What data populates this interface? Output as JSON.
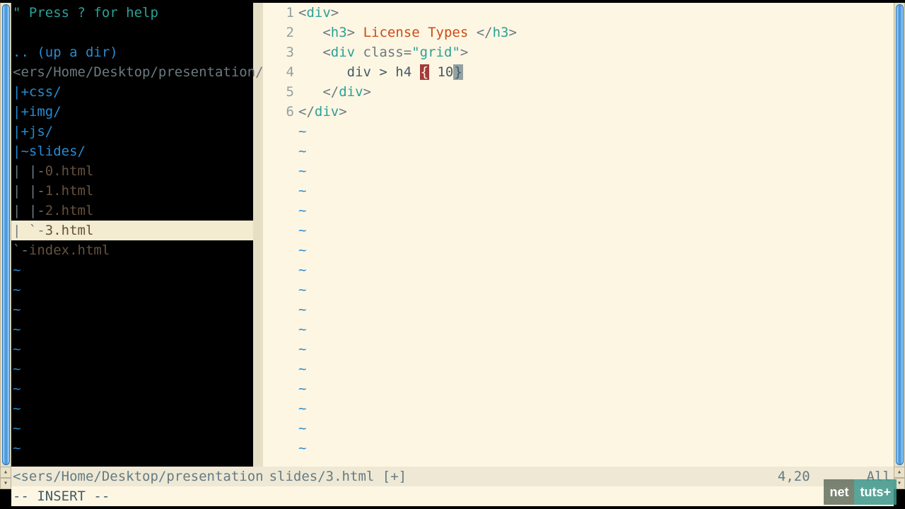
{
  "tree": {
    "help": "\" Press ? for help",
    "updir": ".. (up a dir)",
    "path": "<ers/Home/Desktop/presentation/",
    "items": [
      "|+css/",
      "|+img/",
      "|+js/",
      "|~slides/",
      "| |-0.html",
      "| |-1.html",
      "| |-2.html",
      "| `-3.html",
      "`-index.html"
    ],
    "current_index": 7
  },
  "editor": {
    "lines": [
      {
        "num": "1",
        "indent": "",
        "segments": [
          {
            "t": "<",
            "c": "tag"
          },
          {
            "t": "div",
            "c": "teal"
          },
          {
            "t": ">",
            "c": "tag"
          }
        ]
      },
      {
        "num": "2",
        "indent": "   ",
        "segments": [
          {
            "t": "<",
            "c": "tag"
          },
          {
            "t": "h3",
            "c": "teal"
          },
          {
            "t": "> ",
            "c": "tag"
          },
          {
            "t": "License Types",
            "c": "orange"
          },
          {
            "t": " </",
            "c": "tag"
          },
          {
            "t": "h3",
            "c": "teal"
          },
          {
            "t": ">",
            "c": "tag"
          }
        ]
      },
      {
        "num": "3",
        "indent": "   ",
        "segments": [
          {
            "t": "<",
            "c": "tag"
          },
          {
            "t": "div ",
            "c": "teal"
          },
          {
            "t": "class=",
            "c": "attr"
          },
          {
            "t": "\"grid\"",
            "c": "teal"
          },
          {
            "t": ">",
            "c": "tag"
          }
        ]
      },
      {
        "num": "4",
        "indent": "      ",
        "segments": [
          {
            "t": "div > h4 ",
            "c": "body"
          },
          {
            "t": "{",
            "c": "hl-open"
          },
          {
            "t": " 10",
            "c": "body"
          },
          {
            "t": "}",
            "c": "hl-close"
          }
        ]
      },
      {
        "num": "5",
        "indent": "   ",
        "segments": [
          {
            "t": "</",
            "c": "tag"
          },
          {
            "t": "div",
            "c": "teal"
          },
          {
            "t": ">",
            "c": "tag"
          }
        ]
      },
      {
        "num": "6",
        "indent": "",
        "segments": [
          {
            "t": "</",
            "c": "tag"
          },
          {
            "t": "div",
            "c": "teal"
          },
          {
            "t": ">",
            "c": "tag"
          }
        ]
      }
    ],
    "empty_rows": 17
  },
  "status": {
    "left_path": "<sers/Home/Desktop/presentation",
    "file": " slides/3.html [+]",
    "pos": "4,20",
    "pct": "All",
    "mode": "-- INSERT --"
  },
  "watermark": {
    "left": "net",
    "right": "tuts+"
  }
}
